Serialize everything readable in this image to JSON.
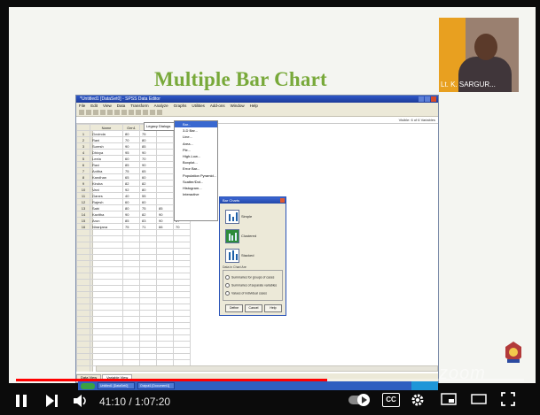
{
  "slide": {
    "title": "Multiple Bar Chart",
    "presenter_name": "Lt. K. SARGUR..."
  },
  "spss": {
    "window_title": "*Untitled1 [DataSet0] - SPSS Data Editor",
    "menus": [
      "File",
      "Edit",
      "View",
      "Data",
      "Transform",
      "Analyze",
      "Graphs",
      "Utilities",
      "Add-ons",
      "Window",
      "Help"
    ],
    "visible_vars": "Visible: 6 of 6 Variables",
    "columns": [
      "",
      "Name",
      "Gen1",
      "Gen2",
      "Gen3",
      "Gen4"
    ],
    "rows": [
      [
        "1",
        "Govinda",
        "80",
        "75",
        "",
        ""
      ],
      [
        "2",
        "Rani",
        "70",
        "80",
        "",
        ""
      ],
      [
        "3",
        "Suresh",
        "90",
        "85",
        "",
        ""
      ],
      [
        "4",
        "Dhivya",
        "95",
        "90",
        "",
        ""
      ],
      [
        "5",
        "Leela",
        "60",
        "70",
        "",
        ""
      ],
      [
        "6",
        "Ravi",
        "85",
        "90",
        "",
        ""
      ],
      [
        "7",
        "Anitha",
        "75",
        "65",
        "",
        ""
      ],
      [
        "8",
        "Kandhan",
        "65",
        "60",
        "",
        ""
      ],
      [
        "9",
        "Kiruba",
        "82",
        "82",
        "",
        ""
      ],
      [
        "10",
        "Vani",
        "92",
        "80",
        "",
        ""
      ],
      [
        "11",
        "Ganes",
        "40",
        "55",
        "",
        ""
      ],
      [
        "12",
        "Rajesh",
        "60",
        "60",
        "",
        ""
      ],
      [
        "13",
        "Sabi",
        "80",
        "75",
        "85",
        "80"
      ],
      [
        "14",
        "Kavitha",
        "90",
        "82",
        "90",
        "95"
      ],
      [
        "15",
        "Arun",
        "85",
        "83",
        "90",
        "87"
      ],
      [
        "16",
        "Niranjana",
        "75",
        "71",
        "66",
        "70"
      ]
    ],
    "sheet_tabs": [
      "Data View",
      "Variable View"
    ]
  },
  "graphs_menu": {
    "item": "Legacy Dialogs",
    "options": [
      "Bar...",
      "3-D Bar...",
      "Line...",
      "Area...",
      "Pie...",
      "High-Low...",
      "Boxplot...",
      "Error Bar...",
      "Population Pyramid...",
      "Scatter/Dot...",
      "Histogram...",
      "Interactive"
    ]
  },
  "bar_dialog": {
    "title": "Bar Charts",
    "opt_simple": "Simple",
    "opt_clustered": "Clustered",
    "opt_stacked": "Stacked",
    "section_title": "Data in Chart Are",
    "radio1": "Summaries for groups of cases",
    "radio2": "Summaries of separate variables",
    "radio3": "Values of individual cases",
    "define": "Define",
    "cancel": "Cancel",
    "help": "Help"
  },
  "taskbar": {
    "items": [
      "Untitled1 [DataSet0]",
      "Output1 [Document1]"
    ]
  },
  "player": {
    "time_text": "41:10 / 1:07:20",
    "progress": 0.612,
    "cc_label": "CC",
    "watermark": "zoom"
  }
}
